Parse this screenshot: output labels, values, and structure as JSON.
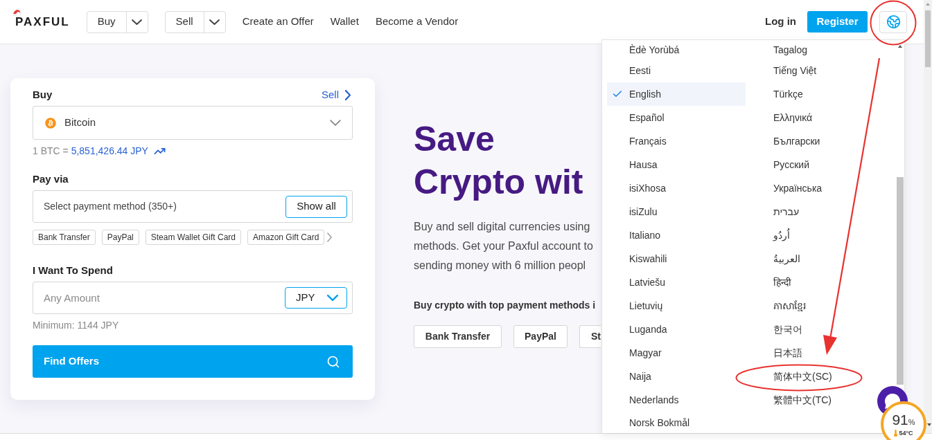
{
  "header": {
    "logo": "PAXFUL",
    "nav": [
      {
        "kind": "split",
        "label": "Buy"
      },
      {
        "kind": "split",
        "label": "Sell"
      },
      {
        "kind": "link",
        "label": "Create an Offer"
      },
      {
        "kind": "link",
        "label": "Wallet"
      },
      {
        "kind": "link",
        "label": "Become a Vendor"
      }
    ],
    "login": "Log in",
    "register": "Register"
  },
  "trade_card": {
    "title": "Buy",
    "switch_link": "Sell",
    "asset": "Bitcoin",
    "rate_prefix": "1 BTC =",
    "rate_value": "5,851,426.44 JPY",
    "pay_label": "Pay via",
    "pay_prompt": "Select payment method (350+)",
    "show_all": "Show all",
    "methods": [
      "Bank Transfer",
      "PayPal",
      "Steam Wallet Gift Card",
      "Amazon Gift Card"
    ],
    "spend_label": "I Want To Spend",
    "amount": {
      "placeholder": "Any Amount"
    },
    "currency": "JPY",
    "minimum": "Minimum: 1144 JPY",
    "submit": "Find Offers"
  },
  "hero": {
    "title_lines": [
      "Save",
      "Crypto wit"
    ],
    "description_lines": [
      "Buy and sell digital currencies using",
      "methods. Get your Paxful account to",
      "sending money with 6 million peopl"
    ],
    "methods_heading": "Buy crypto with top payment methods i",
    "method_buttons": [
      "Bank Transfer",
      "PayPal",
      "St"
    ]
  },
  "language_menu": {
    "languages": [
      {
        "label": "Èdè Yorùbá",
        "selected": false
      },
      {
        "label": "Eesti",
        "selected": false
      },
      {
        "label": "English",
        "selected": true
      },
      {
        "label": "Español",
        "selected": false
      },
      {
        "label": "Français",
        "selected": false
      },
      {
        "label": "Hausa",
        "selected": false
      },
      {
        "label": "isiXhosa",
        "selected": false
      },
      {
        "label": "isiZulu",
        "selected": false
      },
      {
        "label": "Italiano",
        "selected": false
      },
      {
        "label": "Kiswahili",
        "selected": false
      },
      {
        "label": "Latviešu",
        "selected": false
      },
      {
        "label": "Lietuvių",
        "selected": false
      },
      {
        "label": "Luganda",
        "selected": false
      },
      {
        "label": "Magyar",
        "selected": false
      },
      {
        "label": "Naija",
        "selected": false
      },
      {
        "label": "Nederlands",
        "selected": false
      },
      {
        "label": "Norsk Bokmål",
        "selected": false
      },
      {
        "label": "Tagalog",
        "selected": false
      },
      {
        "label": "Tiếng Việt",
        "selected": false
      },
      {
        "label": "Türkçe",
        "selected": false
      },
      {
        "label": "Ελληνικά",
        "selected": false
      },
      {
        "label": "Български",
        "selected": false
      },
      {
        "label": "Русский",
        "selected": false
      },
      {
        "label": "Українська",
        "selected": false
      },
      {
        "label": "עברית",
        "selected": false
      },
      {
        "label": "اُردُو",
        "selected": false
      },
      {
        "label": "العربيةُ",
        "selected": false
      },
      {
        "label": "हिन्दी",
        "selected": false
      },
      {
        "label": "ភាសាខ្មែរ",
        "selected": false
      },
      {
        "label": "한국어",
        "selected": false
      },
      {
        "label": "日本語",
        "selected": false
      },
      {
        "label": "简体中文(SC)",
        "selected": false
      },
      {
        "label": "繁體中文(TC)",
        "selected": false
      }
    ]
  },
  "system_monitor": {
    "load": "91",
    "unit": "%",
    "temperature": "54°C"
  }
}
